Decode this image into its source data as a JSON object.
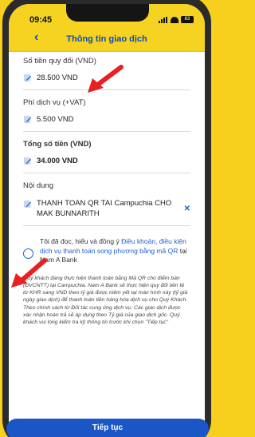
{
  "status_bar": {
    "time": "09:45",
    "battery": "83"
  },
  "header": {
    "back_icon": "chevron-left-icon",
    "title": "Thông tin giao dịch"
  },
  "fields": {
    "converted_amount": {
      "label": "Số tiền quy đổi (VND)",
      "value": "28.500 VND"
    },
    "service_fee": {
      "label": "Phí dịch vụ (+VAT)",
      "value": "5.500 VND"
    },
    "total_amount": {
      "label": "Tổng số tiền (VND)",
      "value": "34.000 VND"
    },
    "content": {
      "label": "Nội dung",
      "value": "THANH TOAN QR TAI Campuchia CHO MAK BUNNARITH",
      "clear_icon": "close-icon"
    }
  },
  "agreement": {
    "prefix": "Tôi đã đọc, hiểu và đồng ý ",
    "link": "Điều khoản, điều kiện dịch vụ thanh toán song phương bằng mã QR",
    "suffix": " tại Nam A Bank"
  },
  "note": {
    "para1": "Quý khách đang thực hiện thanh toán bằng Mã QR cho điểm bán (ĐVCNTT) tại Campuchia. Nam A Bank sẽ thực hiện quy đổi tiền tệ từ KHR sang VND theo tỷ giá được niêm yết tại màn hình này (tỷ giá ngày giao dịch) để thanh toán tiền hàng hóa dịch vụ cho Quý Khách.",
    "para2": "Theo chính sách từ Đối tác cung ứng dịch vụ: Các giao dịch được xác nhận hoàn trả sẽ áp dụng theo Tỷ giá của giao dịch gốc. Quý khách vui lòng kiểm tra kỹ thông tin trước khi chọn \"Tiếp tục\""
  },
  "cta": {
    "label": "Tiếp tục"
  },
  "colors": {
    "brand_yellow": "#F6D321",
    "brand_blue": "#1B56C7",
    "arrow_red": "#E82020"
  }
}
